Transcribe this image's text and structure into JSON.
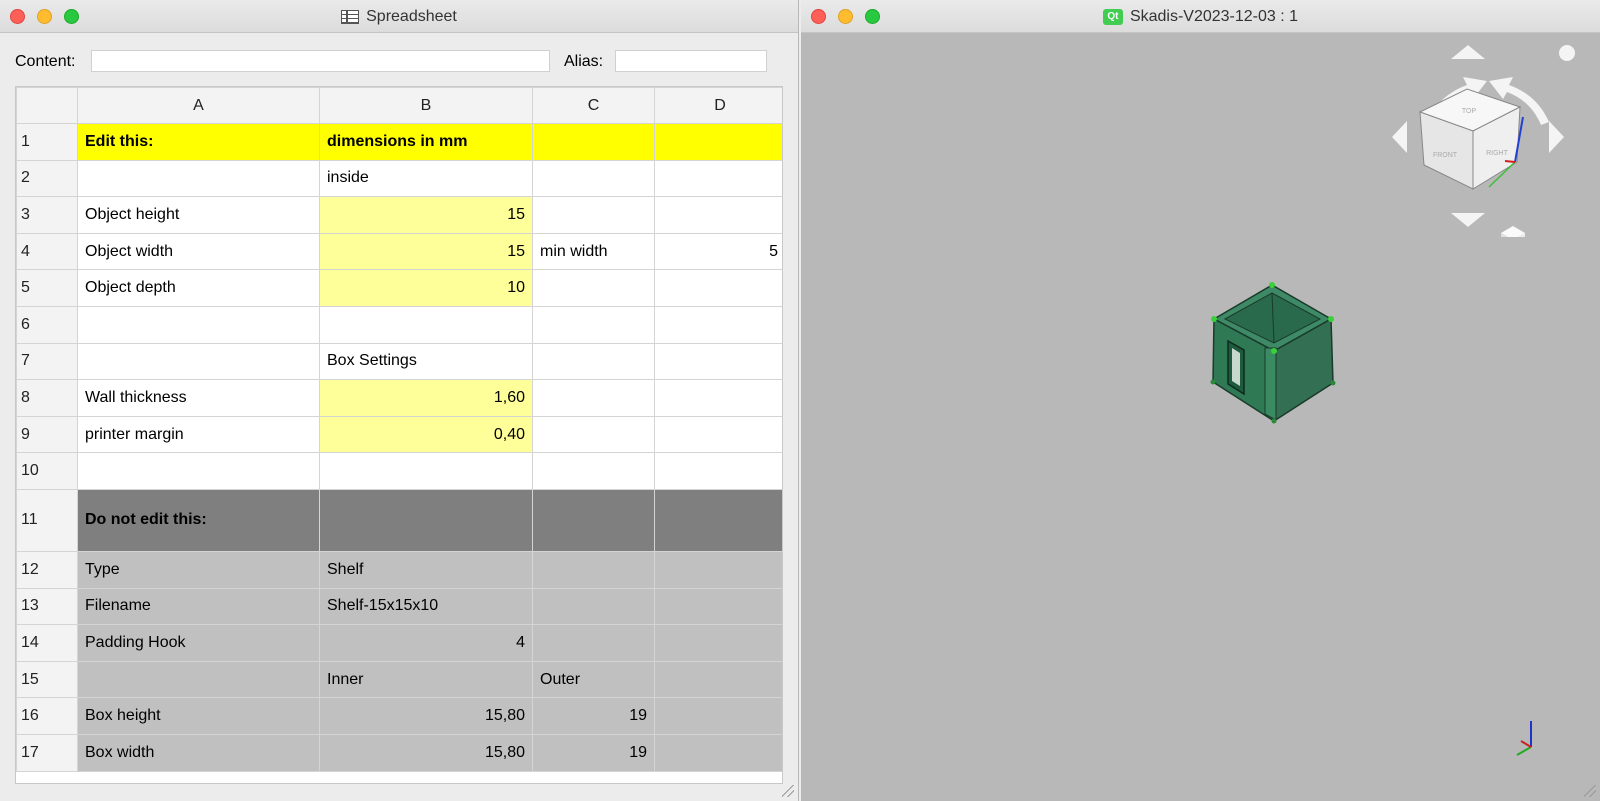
{
  "sheet_window": {
    "title": "Spreadsheet",
    "content_label": "Content:",
    "content_value": "",
    "alias_label": "Alias:",
    "alias_value": "",
    "columns": [
      "A",
      "B",
      "C",
      "D"
    ],
    "rows": [
      {
        "num": "1",
        "style": "yel",
        "bold": true,
        "cells": [
          "Edit this:",
          "dimensions in mm",
          "",
          ""
        ]
      },
      {
        "num": "2",
        "style": "white",
        "cells": [
          "",
          "inside",
          "",
          ""
        ]
      },
      {
        "num": "3",
        "style": "white",
        "b_style": "ltyel",
        "num_cols": [
          1
        ],
        "cells": [
          "Object height",
          "15",
          "",
          ""
        ]
      },
      {
        "num": "4",
        "style": "white",
        "b_style": "ltyel",
        "num_cols": [
          1,
          3
        ],
        "cells": [
          "Object width",
          "15",
          "min width",
          "5"
        ]
      },
      {
        "num": "5",
        "style": "white",
        "b_style": "ltyel",
        "num_cols": [
          1
        ],
        "cells": [
          "Object depth",
          "10",
          "",
          ""
        ]
      },
      {
        "num": "6",
        "style": "white",
        "cells": [
          "",
          "",
          "",
          ""
        ]
      },
      {
        "num": "7",
        "style": "white",
        "cells": [
          "",
          "Box Settings",
          "",
          ""
        ]
      },
      {
        "num": "8",
        "style": "white",
        "b_style": "ltyel",
        "num_cols": [
          1
        ],
        "cells": [
          "Wall thickness",
          "1,60",
          "",
          ""
        ]
      },
      {
        "num": "9",
        "style": "white",
        "b_style": "ltyel",
        "num_cols": [
          1
        ],
        "cells": [
          "printer margin",
          "0,40",
          "",
          ""
        ]
      },
      {
        "num": "10",
        "style": "white",
        "cells": [
          "",
          "",
          "",
          ""
        ]
      },
      {
        "num": "11",
        "style": "dark",
        "bold": true,
        "tall": true,
        "cells": [
          "Do not edit this:",
          "",
          "",
          ""
        ]
      },
      {
        "num": "12",
        "style": "gray",
        "cells": [
          "Type",
          "Shelf",
          "",
          ""
        ]
      },
      {
        "num": "13",
        "style": "gray",
        "cells": [
          "Filename",
          "Shelf-15x15x10",
          "",
          ""
        ]
      },
      {
        "num": "14",
        "style": "gray",
        "num_cols": [
          1
        ],
        "cells": [
          "Padding Hook",
          "4",
          "",
          ""
        ]
      },
      {
        "num": "15",
        "style": "gray",
        "cells": [
          "",
          "Inner",
          "Outer",
          ""
        ]
      },
      {
        "num": "16",
        "style": "gray",
        "num_cols": [
          1,
          2
        ],
        "cells": [
          "Box height",
          "15,80",
          "19",
          ""
        ]
      },
      {
        "num": "17",
        "style": "gray",
        "num_cols": [
          1,
          2
        ],
        "cells": [
          "Box width",
          "15,80",
          "19",
          ""
        ]
      }
    ]
  },
  "view_window": {
    "title": "Skadis-V2023-12-03 : 1",
    "app_badge": "Qt",
    "navcube_faces": {
      "top": "TOP",
      "front": "FRONT",
      "right": "RIGHT"
    }
  },
  "colors": {
    "cell_yellow": "#ffff00",
    "cell_light_yellow": "#ffff99",
    "cell_dark_gray": "#7f7f7f",
    "cell_gray": "#c0c0c0",
    "viewport_bg": "#b8b8b8",
    "model_green": "#2e7a56"
  },
  "icons": {
    "sheet_title": "spreadsheet-icon",
    "view_title": "qt-logo-icon",
    "navcube": "navigation-cube-icon",
    "axis": "axis-cross-icon"
  }
}
